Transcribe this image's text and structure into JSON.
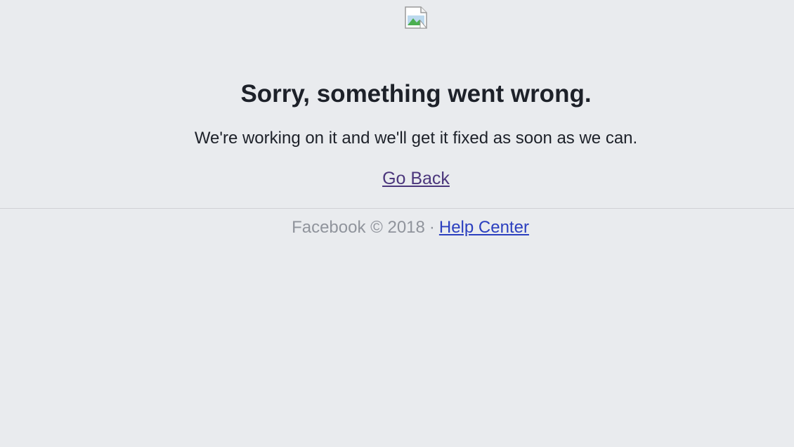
{
  "header": {
    "image_icon": "broken-image-icon"
  },
  "main": {
    "headline": "Sorry, something went wrong.",
    "message": "We're working on it and we'll get it fixed as soon as we can.",
    "go_back_label": "Go Back"
  },
  "footer": {
    "copyright": "Facebook © 2018",
    "separator": "·",
    "help_center_label": "Help Center"
  },
  "colors": {
    "background": "#e9ebee",
    "text": "#1d2129",
    "visited_link": "#4b367c",
    "link": "#2b3fbf",
    "muted": "#90949c"
  }
}
